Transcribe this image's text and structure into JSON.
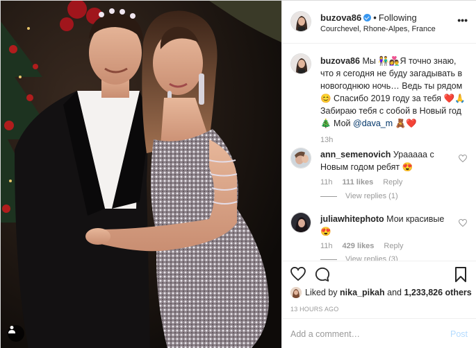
{
  "post": {
    "username": "buzova86",
    "follow_status": "Following",
    "location": "Courchevel, Rhone-Alpes, France",
    "more": "•••"
  },
  "caption": {
    "username": "buzova86",
    "text_1": " Мы 👫👩‍❤️‍👨",
    "text_2": "Я точно знаю, что я сегодня не буду загадывать в новогоднюю ночь… Ведь ты рядом 😊 Спасибо 2019 году за тебя ❤️🙏 Забираю тебя с собой в Новый год 🎄 Мой ",
    "mention": "@dava_m",
    "text_3": " 🧸❤️",
    "time": "13h"
  },
  "comments": [
    {
      "username": "ann_semenovich",
      "text": " Урааааа с Новым годом ребят 😍",
      "time": "11h",
      "likes": "111 likes",
      "reply": "Reply",
      "view_replies": "View replies (1)"
    },
    {
      "username": "juliawhitephoto",
      "text": " Мои красивые 😍",
      "time": "11h",
      "likes": "429 likes",
      "reply": "Reply",
      "view_replies": "View replies (3)"
    }
  ],
  "likes": {
    "prefix": "Liked by ",
    "user": "nika_pikah",
    "middle": " and ",
    "count": "1,233,826 others"
  },
  "time_ago": "13 HOURS AGO",
  "add_comment": {
    "placeholder": "Add a comment…",
    "post_label": "Post"
  },
  "colors": {
    "verified": "#3897f0",
    "mention": "#003569",
    "post_disabled": "#b3dbff",
    "border": "#efefef"
  },
  "icons": [
    "heart-icon",
    "comment-icon",
    "bookmark-icon",
    "user-tag-icon",
    "more-options-icon",
    "verified-badge-icon"
  ]
}
